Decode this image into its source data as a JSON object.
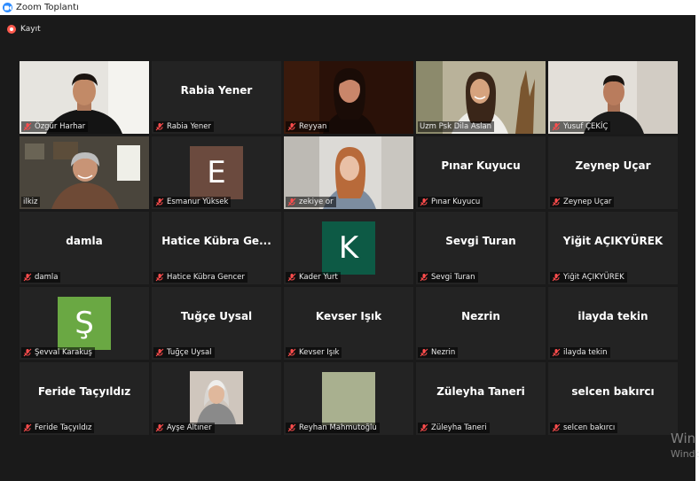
{
  "window": {
    "title": "Zoom Toplantı"
  },
  "recording": {
    "label": "Kayıt"
  },
  "colors": {
    "active_speaker": "#c8e34a",
    "muted_mic": "#ff4d4d",
    "tile_bg": "#232323"
  },
  "participants": [
    {
      "name": "Özgür Harhar",
      "type": "video"
    },
    {
      "name": "Rabia Yener",
      "display": "Rabia Yener",
      "type": "name"
    },
    {
      "name": "Reyyan",
      "type": "video"
    },
    {
      "name": "Uzm Psk Dila Aslan",
      "type": "video"
    },
    {
      "name": "Yusuf ÇEKİÇ",
      "type": "video"
    },
    {
      "name": "ilkiz",
      "type": "video",
      "active": true
    },
    {
      "name": "Esmanur Yüksek",
      "type": "avatar",
      "initial": "E",
      "color": "#6b4a3e"
    },
    {
      "name": "zekiye or",
      "type": "video"
    },
    {
      "name": "Pınar Kuyucu",
      "display": "Pınar Kuyucu",
      "type": "name"
    },
    {
      "name": "Zeynep Uçar",
      "display": "Zeynep Uçar",
      "type": "name"
    },
    {
      "name": "damla",
      "display": "damla",
      "type": "name"
    },
    {
      "name": "Hatice Kübra Gencer",
      "display": "Hatice Kübra Ge...",
      "type": "name"
    },
    {
      "name": "Kader Yurt",
      "type": "avatar",
      "initial": "K",
      "color": "#0d5a45"
    },
    {
      "name": "Sevgi Turan",
      "display": "Sevgi Turan",
      "type": "name"
    },
    {
      "name": "Yiğit AÇIKYÜREK",
      "display": "Yiğit AÇIKYÜREK",
      "type": "name"
    },
    {
      "name": "Şevval Karakuş",
      "type": "avatar",
      "initial": "Ş",
      "color": "#6aa843"
    },
    {
      "name": "Tuğçe Uysal",
      "display": "Tuğçe Uysal",
      "type": "name"
    },
    {
      "name": "Kevser Işık",
      "display": "Kevser Işık",
      "type": "name"
    },
    {
      "name": "Nezrin",
      "display": "Nezrin",
      "type": "name"
    },
    {
      "name": "ilayda tekin",
      "display": "ilayda tekin",
      "type": "name"
    },
    {
      "name": "Feride Taçyıldız",
      "display": "Feride Taçyıldız",
      "type": "name"
    },
    {
      "name": "Ayşe Altıner",
      "type": "photo"
    },
    {
      "name": "Reyhan Mahmutoğlu",
      "type": "blank-avatar",
      "color": "#a9b08f"
    },
    {
      "name": "Züleyha Taneri",
      "display": "Züleyha Taneri",
      "type": "name"
    },
    {
      "name": "selcen bakırcı",
      "display": "selcen bakırcı",
      "type": "name"
    }
  ],
  "watermark": {
    "line1": "Win",
    "line2": "Windo"
  }
}
